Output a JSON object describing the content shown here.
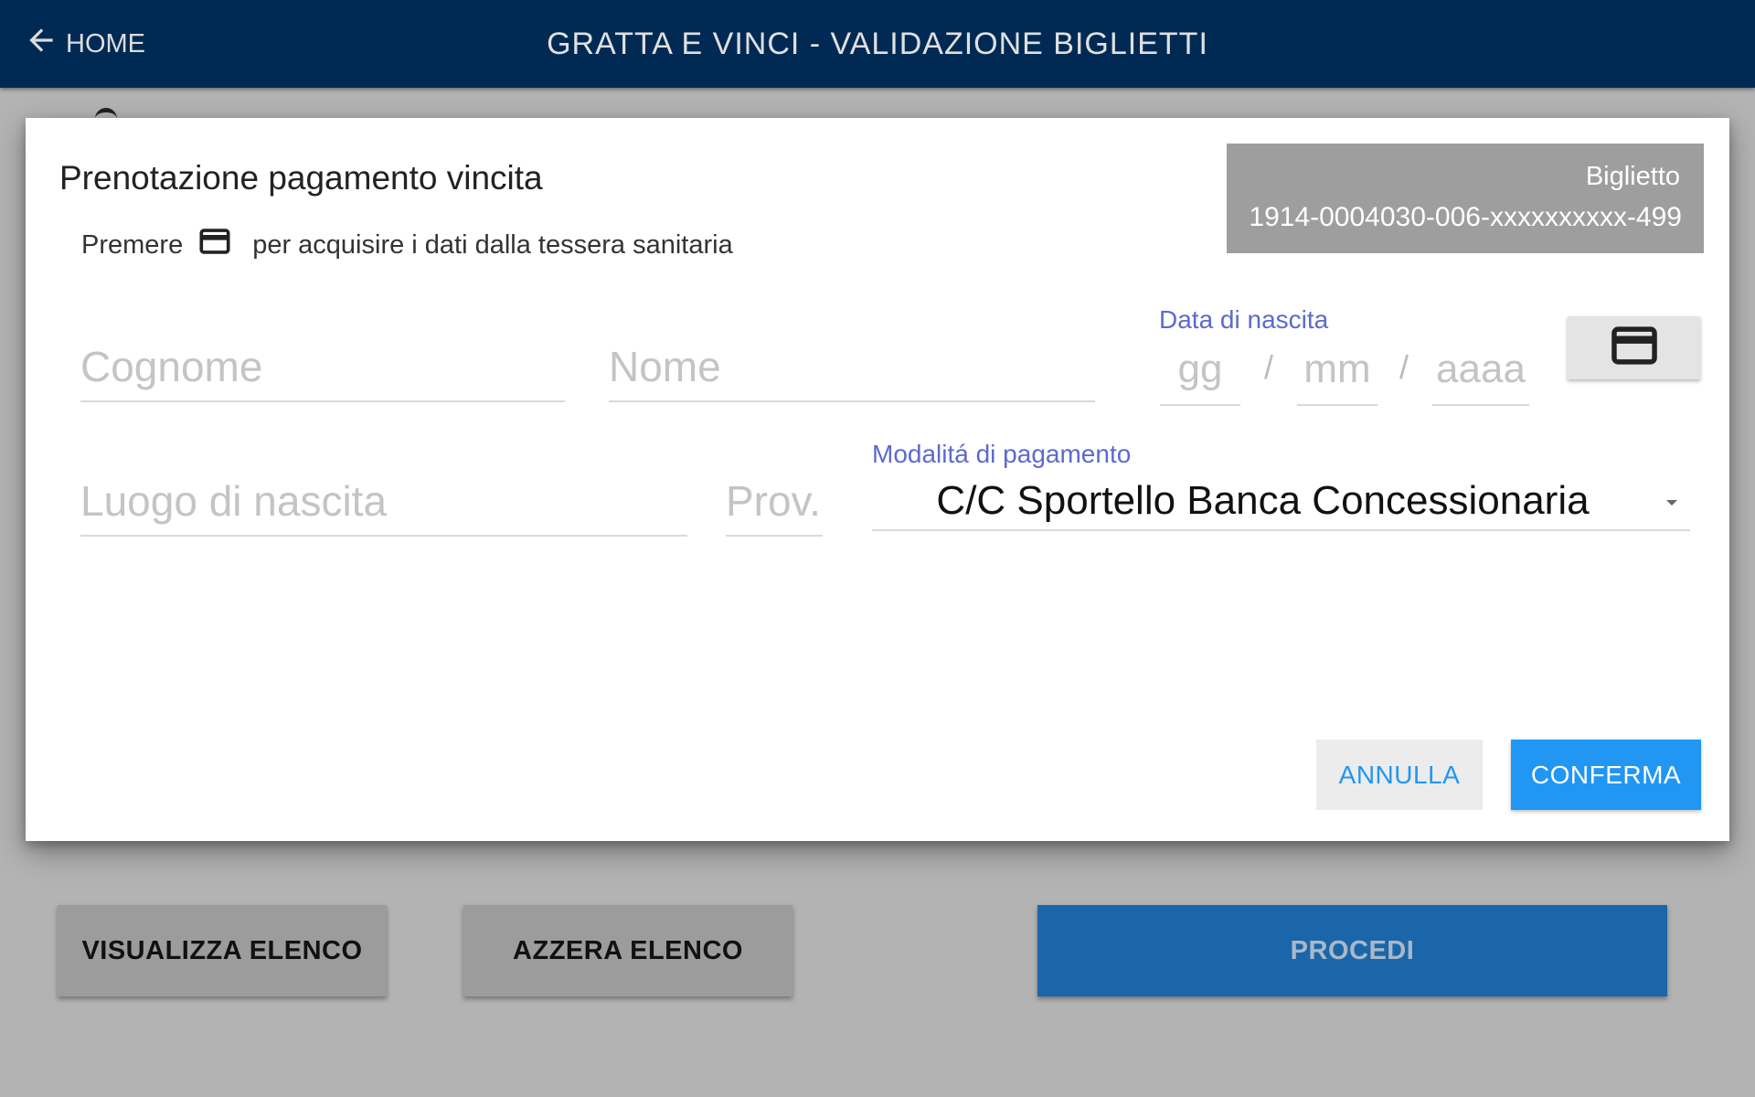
{
  "header": {
    "home_label": "HOME",
    "title": "GRATTA E VINCI - VALIDAZIONE BIGLIETTI"
  },
  "dialog": {
    "title": "Prenotazione pagamento vincita",
    "hint_before": "Premere",
    "hint_after": "per acquisire i dati dalla tessera sanitaria",
    "ticket_label": "Biglietto",
    "ticket_number": "1914-0004030-006-xxxxxxxxxx-499",
    "fields": {
      "cognome": {
        "value": "",
        "placeholder": "Cognome"
      },
      "nome": {
        "value": "",
        "placeholder": "Nome"
      },
      "luogo_nascita": {
        "value": "",
        "placeholder": "Luogo di nascita"
      },
      "prov": {
        "value": "",
        "placeholder": "Prov."
      }
    },
    "data_nascita": {
      "label": "Data di nascita",
      "gg_placeholder": "gg",
      "mm_placeholder": "mm",
      "aaaa_placeholder": "aaaa",
      "separator": "/"
    },
    "modalita_pagamento": {
      "label": "Modalitá di pagamento",
      "selected": "C/C Sportello Banca Concessionaria"
    },
    "cancel_label": "ANNULLA",
    "confirm_label": "CONFERMA"
  },
  "footer": {
    "visualizza_label": "VISUALIZZA ELENCO",
    "azzera_label": "AZZERA ELENCO",
    "procedi_label": "PROCEDI"
  },
  "colors": {
    "header_bg": "#002a53",
    "accent": "#2196f3",
    "procedi_bg": "#1a66a9",
    "label_blue": "#5b6ad0"
  },
  "icons": {
    "back": "arrow-left-icon",
    "card": "credit-card-icon",
    "caret": "chevron-down-icon"
  }
}
